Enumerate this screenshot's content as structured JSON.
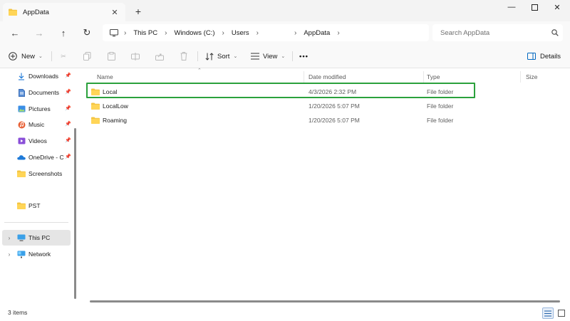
{
  "tab": {
    "title": "AppData",
    "icon": "folder-icon"
  },
  "window_controls": {
    "minimize": "minimize-icon",
    "maximize": "maximize-icon",
    "close": "close-icon"
  },
  "navigation": {
    "back": "back-arrow-icon",
    "forward": "forward-arrow-icon",
    "up": "up-arrow-icon",
    "refresh": "refresh-icon"
  },
  "breadcrumb": {
    "items": [
      "This PC",
      "Windows (C:)",
      "Users",
      "",
      "AppData"
    ]
  },
  "search": {
    "placeholder": "Search AppData"
  },
  "toolbar": {
    "new_label": "New",
    "sort_label": "Sort",
    "view_label": "View",
    "more_label": "•••",
    "details_label": "Details"
  },
  "sidebar": {
    "quick_access": [
      {
        "label": "Downloads",
        "icon": "download-icon",
        "pinned": true
      },
      {
        "label": "Documents",
        "icon": "documents-icon",
        "pinned": true
      },
      {
        "label": "Pictures",
        "icon": "pictures-icon",
        "pinned": true
      },
      {
        "label": "Music",
        "icon": "music-icon",
        "pinned": true
      },
      {
        "label": "Videos",
        "icon": "videos-icon",
        "pinned": true
      },
      {
        "label": "OneDrive - C",
        "icon": "onedrive-icon",
        "pinned": true
      },
      {
        "label": "Screenshots",
        "icon": "folder-icon",
        "pinned": false
      },
      {
        "label": "PST",
        "icon": "folder-icon",
        "pinned": false
      }
    ],
    "locations": [
      {
        "label": "This PC",
        "icon": "computer-icon",
        "selected": true
      },
      {
        "label": "Network",
        "icon": "network-icon",
        "selected": false
      }
    ]
  },
  "columns": {
    "name": "Name",
    "date": "Date modified",
    "type": "Type",
    "size": "Size"
  },
  "files": [
    {
      "name": "Local",
      "date": "4/3/2026 2:32 PM",
      "type": "File folder",
      "highlighted": true
    },
    {
      "name": "LocalLow",
      "date": "1/20/2026 5:07 PM",
      "type": "File folder",
      "highlighted": false
    },
    {
      "name": "Roaming",
      "date": "1/20/2026 5:07 PM",
      "type": "File folder",
      "highlighted": false
    }
  ],
  "status": {
    "item_count": "3 items"
  },
  "colors": {
    "highlight_border": "#2ba13c",
    "folder": "#f4c542",
    "accent": "#0067c0"
  }
}
